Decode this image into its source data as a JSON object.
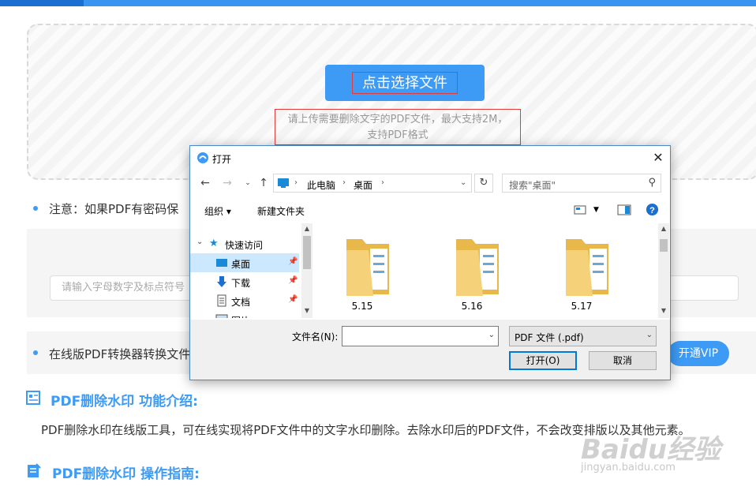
{
  "upload": {
    "button_label": "点击选择文件",
    "hint_line1": "请上传需要删除文字的PDF文件，最大支持2M，",
    "hint_line2": "支持PDF格式"
  },
  "notes": {
    "password_note": "注意：如果PDF有密码保",
    "password_placeholder": "请输入字母数字及标点符号",
    "converter_note": "在线版PDF转换器转换文件",
    "vip_button": "开通VIP"
  },
  "sections": {
    "intro_title": "PDF删除水印 功能介绍:",
    "intro_text": "PDF删除水印在线版工具，可在线实现将PDF文件中的文字水印删除。去除水印后的PDF文件，不会改变排版以及其他元素。",
    "guide_title": "PDF删除水印 操作指南:"
  },
  "watermark": {
    "brand": "Baidu经验",
    "url": "jingyan.baidu.com"
  },
  "dialog": {
    "title": "打开",
    "close": "✕",
    "breadcrumb": [
      "此电脑",
      "桌面"
    ],
    "search_placeholder": "搜索\"桌面\"",
    "toolbar": {
      "organize": "组织 ▾",
      "new_folder": "新建文件夹"
    },
    "nav_items": [
      {
        "label": "快速访问",
        "icon": "star-icon"
      },
      {
        "label": "桌面",
        "icon": "desktop-icon",
        "selected": true
      },
      {
        "label": "下载",
        "icon": "download-icon"
      },
      {
        "label": "文档",
        "icon": "document-icon"
      },
      {
        "label": "图片",
        "icon": "picture-icon"
      }
    ],
    "files": [
      "5.15",
      "5.16",
      "5.17"
    ],
    "filename_label": "文件名(N):",
    "filename_value": "",
    "filetype": "PDF 文件 (.pdf)",
    "open_button": "打开(O)",
    "cancel_button": "取消"
  },
  "colors": {
    "accent": "#3d9bf5",
    "highlight_border": "#e23b3b",
    "dialog_border": "#4a89c8"
  }
}
